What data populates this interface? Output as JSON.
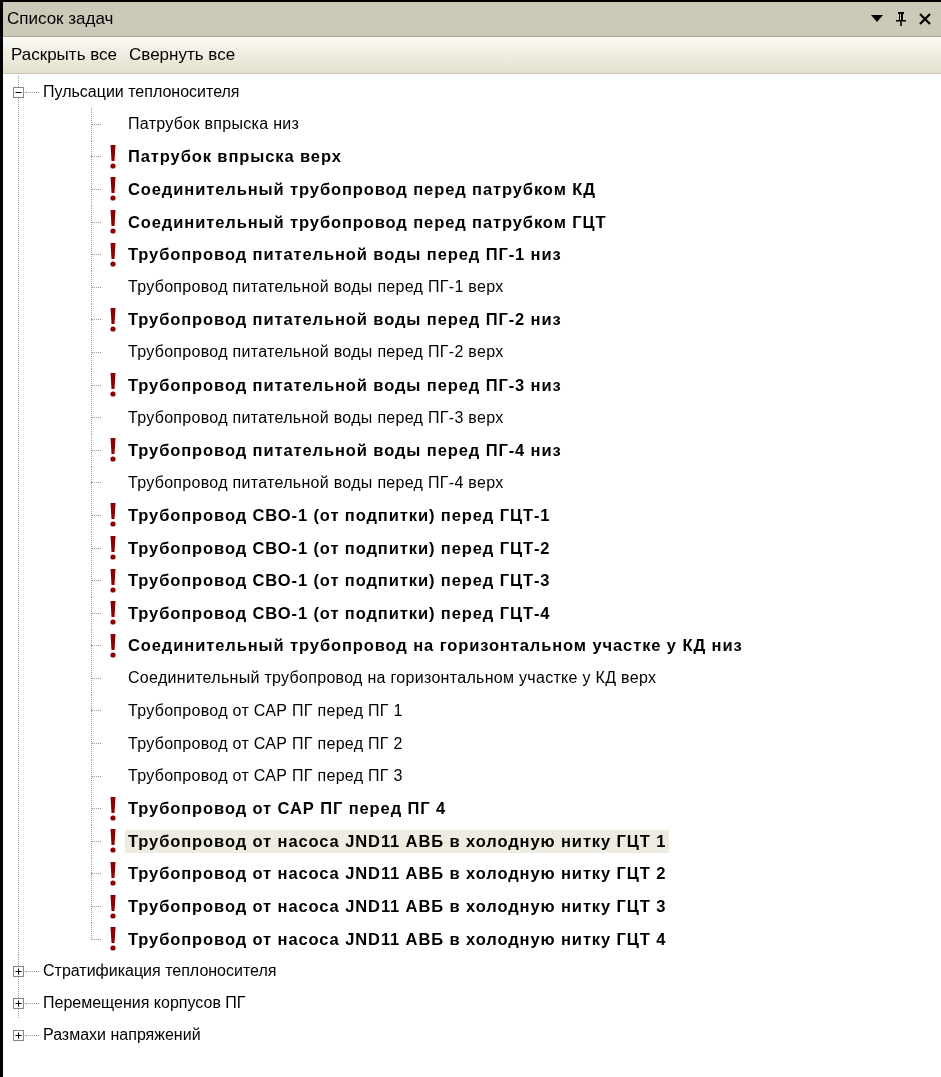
{
  "panel": {
    "title": "Список задач"
  },
  "toolbar": [
    "Раскрыть все",
    "Свернуть все"
  ],
  "tree": [
    {
      "label": "Пульсации теплоносителя",
      "expanded": true,
      "children": [
        {
          "label": "Патрубок впрыска низ",
          "warning": false,
          "selected": false
        },
        {
          "label": "Патрубок впрыска верх",
          "warning": true,
          "selected": false
        },
        {
          "label": "Соединительный трубопровод перед патрубком КД",
          "warning": true,
          "selected": false
        },
        {
          "label": "Соединительный трубопровод перед патрубком ГЦТ",
          "warning": true,
          "selected": false
        },
        {
          "label": "Трубопровод питательной воды перед ПГ-1 низ",
          "warning": true,
          "selected": false
        },
        {
          "label": "Трубопровод питательной воды перед ПГ-1 верх",
          "warning": false,
          "selected": false
        },
        {
          "label": "Трубопровод питательной воды перед ПГ-2 низ",
          "warning": true,
          "selected": false
        },
        {
          "label": "Трубопровод питательной воды перед ПГ-2 верх",
          "warning": false,
          "selected": false
        },
        {
          "label": "Трубопровод питательной воды перед ПГ-3 низ",
          "warning": true,
          "selected": false
        },
        {
          "label": "Трубопровод питательной воды перед ПГ-3 верх",
          "warning": false,
          "selected": false
        },
        {
          "label": "Трубопровод питательной воды перед ПГ-4 низ",
          "warning": true,
          "selected": false
        },
        {
          "label": "Трубопровод питательной воды перед ПГ-4 верх",
          "warning": false,
          "selected": false
        },
        {
          "label": "Трубопровод СВО-1 (от подпитки) перед ГЦТ-1",
          "warning": true,
          "selected": false
        },
        {
          "label": "Трубопровод СВО-1 (от подпитки) перед ГЦТ-2",
          "warning": true,
          "selected": false
        },
        {
          "label": "Трубопровод СВО-1 (от подпитки) перед ГЦТ-3",
          "warning": true,
          "selected": false
        },
        {
          "label": "Трубопровод СВО-1 (от подпитки) перед ГЦТ-4",
          "warning": true,
          "selected": false
        },
        {
          "label": "Соединительный трубопровод на горизонтальном участке у КД низ",
          "warning": true,
          "selected": false
        },
        {
          "label": "Соединительный трубопровод на горизонтальном участке у КД верх",
          "warning": false,
          "selected": false
        },
        {
          "label": "Трубопровод от САР ПГ перед ПГ 1",
          "warning": false,
          "selected": false
        },
        {
          "label": "Трубопровод от САР ПГ перед ПГ 2",
          "warning": false,
          "selected": false
        },
        {
          "label": "Трубопровод от САР ПГ перед ПГ 3",
          "warning": false,
          "selected": false
        },
        {
          "label": "Трубопровод от САР ПГ перед ПГ 4",
          "warning": true,
          "selected": false
        },
        {
          "label": "Трубопровод от насоса JND11 АВБ в холодную нитку ГЦТ 1",
          "warning": true,
          "selected": true
        },
        {
          "label": "Трубопровод от насоса JND11 АВБ в холодную нитку ГЦТ 2",
          "warning": true,
          "selected": false
        },
        {
          "label": "Трубопровод от насоса JND11 АВБ в холодную нитку ГЦТ 3",
          "warning": true,
          "selected": false
        },
        {
          "label": "Трубопровод от насоса JND11 АВБ в холодную нитку ГЦТ 4",
          "warning": true,
          "selected": false
        }
      ]
    },
    {
      "label": "Стратификация  теплоносителя",
      "expanded": false
    },
    {
      "label": "Перемещения корпусов ПГ",
      "expanded": false
    },
    {
      "label": "Размахи напряжений",
      "expanded": false
    }
  ]
}
